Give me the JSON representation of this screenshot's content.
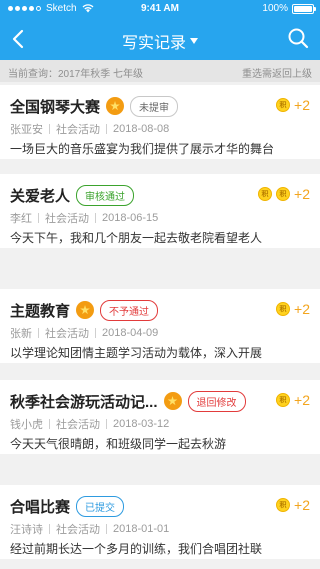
{
  "status": {
    "carrier": "Sketch",
    "time": "9:41 AM",
    "battery_text": "100%",
    "battery_level": 1.0
  },
  "nav": {
    "title": "写实记录",
    "back_icon": "chevron-left-icon",
    "search_icon": "search-icon"
  },
  "query": {
    "label": "当前查询：2017年秋季   七年级",
    "reselect": "重选需返回上级"
  },
  "colors": {
    "primary": "#27a5ee",
    "coin": "#ffd21f",
    "points": "#f3a51e"
  },
  "records": [
    {
      "name": "全国钢琴大赛",
      "medal": true,
      "status": "未提审",
      "status_color": "gray",
      "points": "+2",
      "coins": 1,
      "author": "张亚安",
      "category": "社会活动",
      "date": "2018-08-08",
      "desc": "一场巨大的音乐盛宴为我们提供了展示才华的舞台"
    },
    {
      "name": "关爱老人",
      "medal": false,
      "status": "审核通过",
      "status_color": "green",
      "points": "+2",
      "coins": 2,
      "author": "李红",
      "category": "社会活动",
      "date": "2018-06-15",
      "desc": "今天下午，我和几个朋友一起去敬老院看望老人"
    },
    {
      "name": "主题教育",
      "medal": true,
      "status": "不予通过",
      "status_color": "red",
      "points": "+2",
      "coins": 1,
      "author": "张新",
      "category": "社会活动",
      "date": "2018-04-09",
      "desc": "以学理论知团情主题学习活动为载体，深入开展"
    },
    {
      "name": "秋季社会游玩活动记...",
      "medal": true,
      "status": "退回修改",
      "status_color": "red",
      "points": "+2",
      "coins": 1,
      "author": "钱小虎",
      "category": "社会活动",
      "date": "2018-03-12",
      "desc": "今天天气很晴朗，和班级同学一起去秋游"
    },
    {
      "name": "合唱比赛",
      "medal": false,
      "status": "已提交",
      "status_color": "blue",
      "points": "+2",
      "coins": 1,
      "author": "汪诗诗",
      "category": "社会活动",
      "date": "2018-01-01",
      "desc": "经过前期长达一个多月的训练，我们合唱团社联"
    }
  ]
}
